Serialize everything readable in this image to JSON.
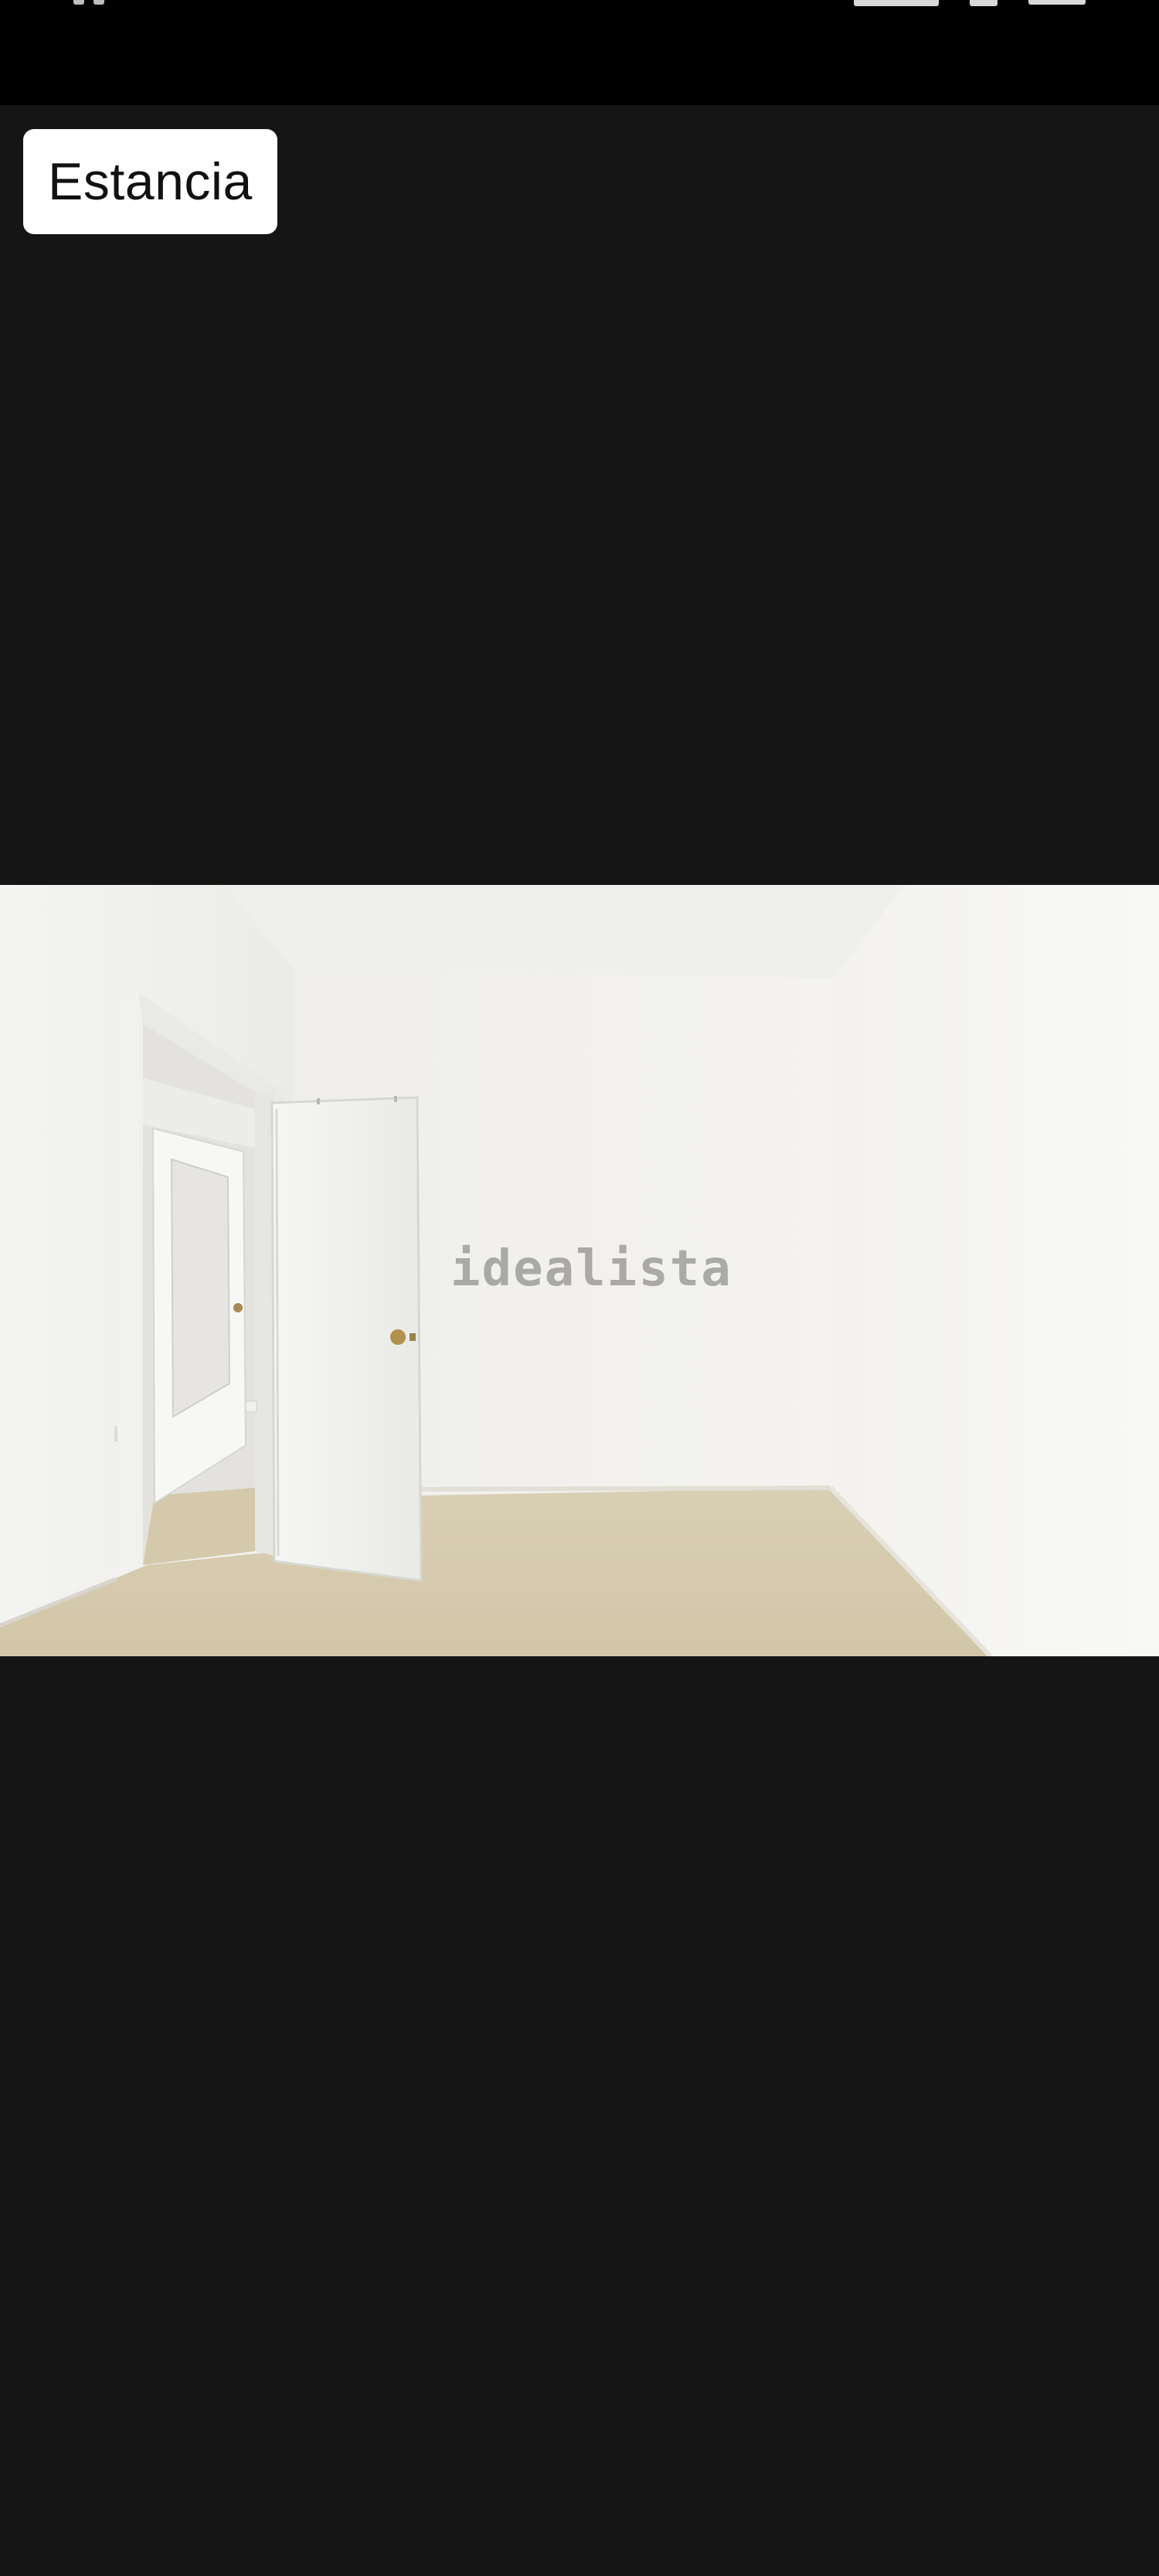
{
  "room_label": "Estancia",
  "watermark": "idealista",
  "icons": {
    "status_signal": "signal-icon",
    "status_wifi": "wifi-icon",
    "status_battery": "battery-icon"
  },
  "colors": {
    "background": "#151515",
    "status_bar": "#000000",
    "badge_background": "#ffffff",
    "badge_text": "#111111"
  }
}
